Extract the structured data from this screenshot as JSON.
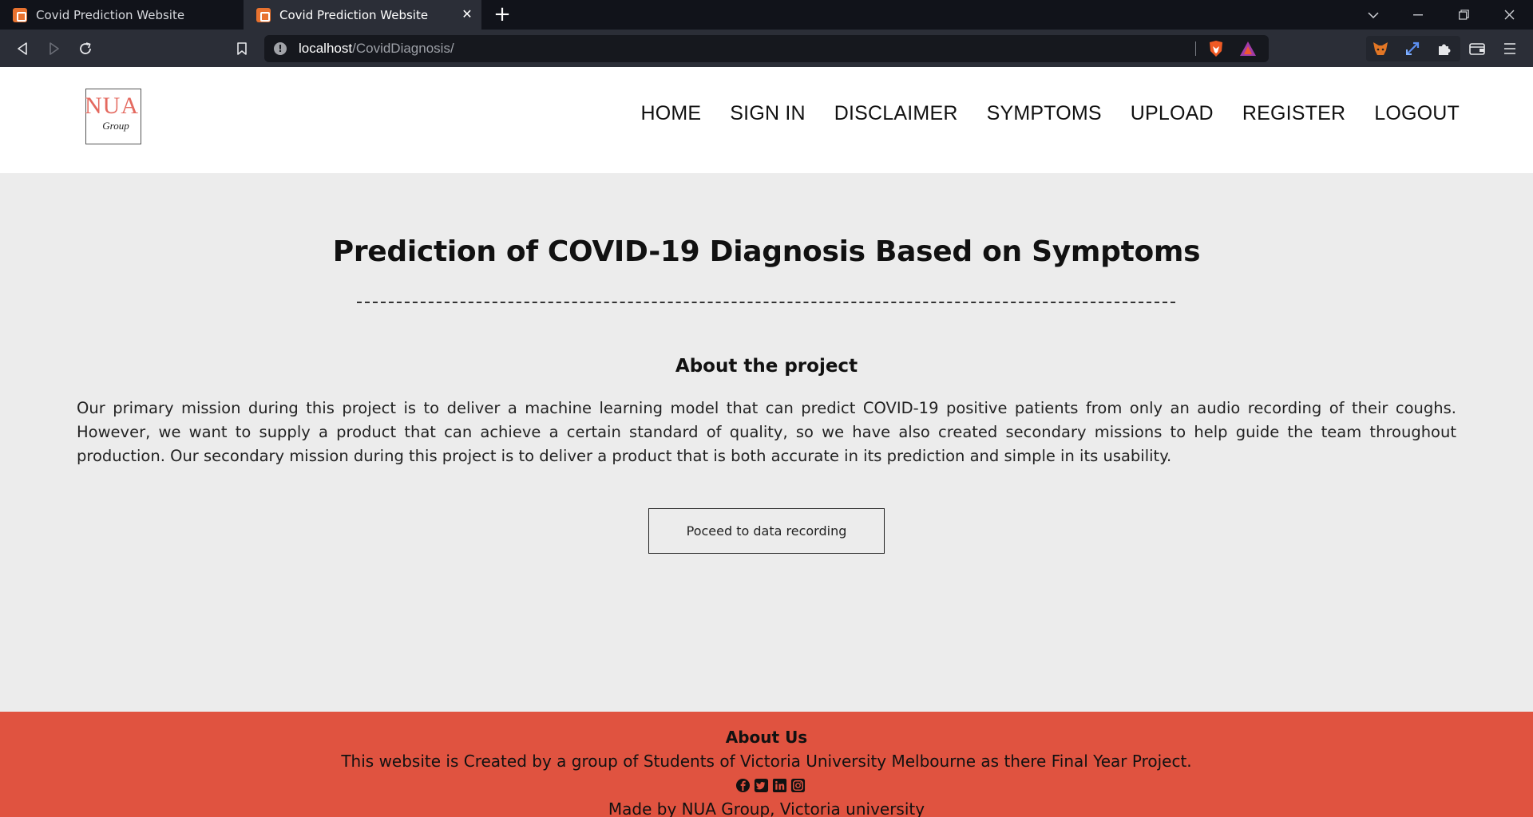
{
  "browser": {
    "tabs": [
      {
        "title": "Covid Prediction Website",
        "active": false
      },
      {
        "title": "Covid Prediction Website",
        "active": true
      }
    ],
    "url_host": "localhost",
    "url_path": "/CovidDiagnosis/"
  },
  "header": {
    "logo_main": "NUA",
    "logo_sub": "Group",
    "nav": [
      "HOME",
      "SIGN IN",
      "DISCLAIMER",
      "SYMPTOMS",
      "UPLOAD",
      "REGISTER",
      "LOGOUT"
    ]
  },
  "main": {
    "title": "Prediction of COVID-19 Diagnosis Based on Symptoms",
    "about_heading": "About the project",
    "about_text": "Our primary mission during this project is to deliver a machine learning model that can predict COVID-19 positive patients from only an audio recording of their coughs. However, we want to supply a product that can achieve a certain standard of quality, so we have also created secondary missions to help guide the team throughout production. Our secondary mission during this project is to deliver a product that is both accurate in its prediction and simple in its usability.",
    "proceed_button": "Poceed to data recording"
  },
  "footer": {
    "title": "About Us",
    "text": "This website is Created by a group of Students of Victoria University Melbourne as there Final Year Project.",
    "social_icons": [
      "facebook-icon",
      "twitter-icon",
      "linkedin-icon",
      "instagram-icon"
    ],
    "made_by": "Made by NUA Group, Victoria university"
  },
  "colors": {
    "footer_bg": "#e05340",
    "page_bg": "#ececec",
    "logo_accent": "#e4695f"
  }
}
